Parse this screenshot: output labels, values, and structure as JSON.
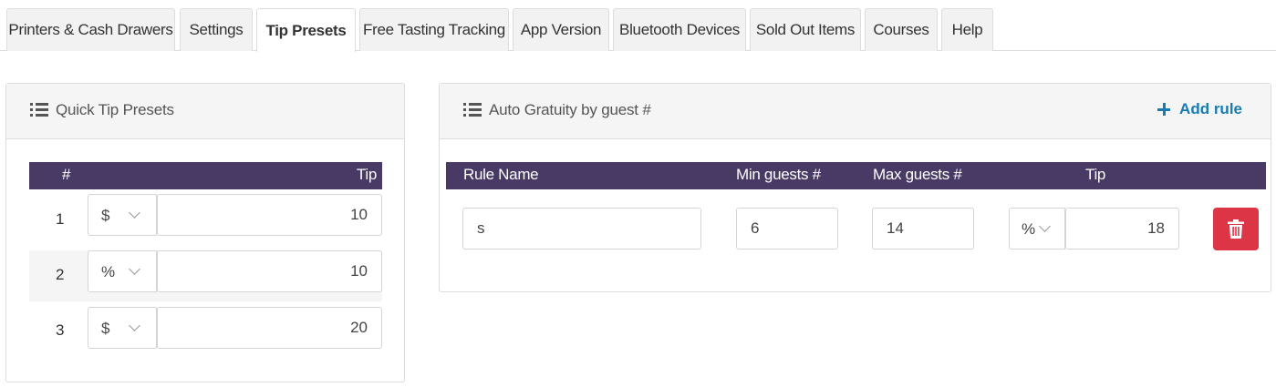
{
  "tabs": [
    {
      "label": "Printers & Cash Drawers",
      "active": false
    },
    {
      "label": "Settings",
      "active": false
    },
    {
      "label": "Tip Presets",
      "active": true
    },
    {
      "label": "Free Tasting Tracking",
      "active": false
    },
    {
      "label": "App Version",
      "active": false
    },
    {
      "label": "Bluetooth Devices",
      "active": false
    },
    {
      "label": "Sold Out Items",
      "active": false
    },
    {
      "label": "Courses",
      "active": false
    },
    {
      "label": "Help",
      "active": false
    }
  ],
  "quick_tips": {
    "title": "Quick Tip Presets",
    "icon": "list-icon",
    "columns": {
      "num": "#",
      "tip": "Tip"
    },
    "rows": [
      {
        "num": "1",
        "type": "$",
        "value": "10"
      },
      {
        "num": "2",
        "type": "%",
        "value": "10"
      },
      {
        "num": "3",
        "type": "$",
        "value": "20"
      }
    ]
  },
  "auto_gratuity": {
    "title": "Auto Gratuity by guest #",
    "icon": "list-icon",
    "add_rule_label": "Add rule",
    "columns": {
      "rule_name": "Rule Name",
      "min": "Min guests #",
      "max": "Max guests #",
      "tip": "Tip"
    },
    "rules": [
      {
        "name": "s",
        "min": "6",
        "max": "14",
        "type": "%",
        "tip": "18"
      }
    ]
  },
  "colors": {
    "header_bg": "#483a64",
    "accent": "#1a7bb0",
    "danger": "#dc3545"
  }
}
